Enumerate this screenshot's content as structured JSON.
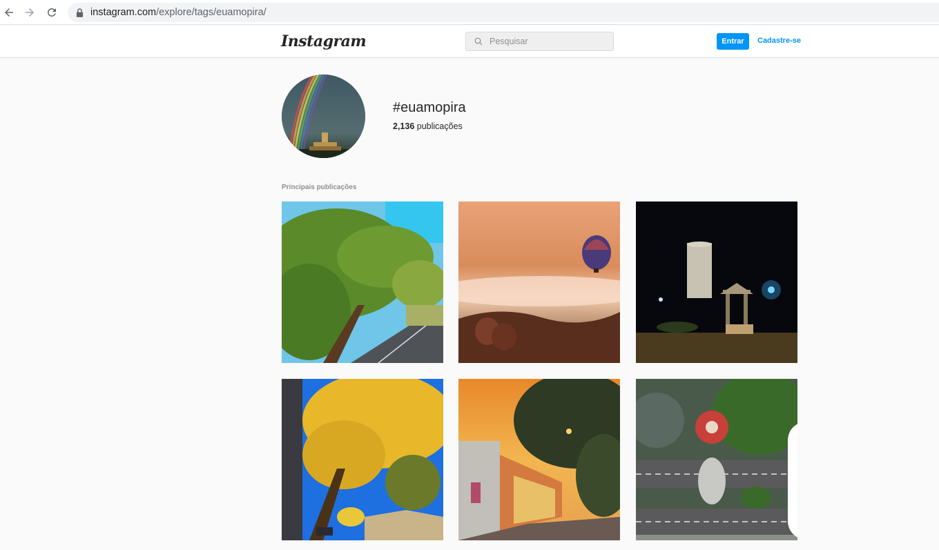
{
  "browser": {
    "url_host": "instagram.com",
    "url_path": "/explore/tags/euamopira/"
  },
  "header": {
    "logo": "Instagram",
    "search_placeholder": "Pesquisar",
    "login_label": "Entrar",
    "signup_label": "Cadastre-se"
  },
  "tag": {
    "name": "#euamopira",
    "count": "2,136",
    "count_suffix": "publicações"
  },
  "section": {
    "label": "Principais publicações"
  },
  "colors": {
    "accent": "#0095f6",
    "text": "#262626",
    "muted": "#8e8e8e",
    "background": "#fafafa"
  },
  "icons": [
    "back-arrow-icon",
    "forward-arrow-icon",
    "reload-icon",
    "lock-icon",
    "search-icon",
    "multiple-posts-icon"
  ],
  "posts": [
    {
      "id": "tree-road"
    },
    {
      "id": "balloons-fog"
    },
    {
      "id": "tower-night"
    },
    {
      "id": "yellow-ipe"
    },
    {
      "id": "sunset-street"
    },
    {
      "id": "aerial-roundabout",
      "multiple": true
    }
  ]
}
